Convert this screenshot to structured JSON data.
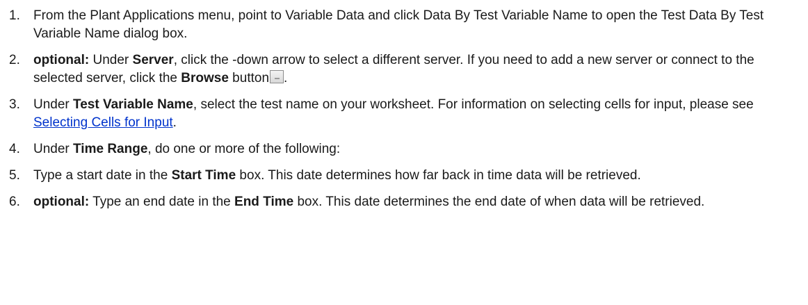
{
  "steps": [
    {
      "num": "1.",
      "parts": {
        "t1": "From the Plant Applications menu, point to Variable Data and click Data By Test Variable Name to open the Test Data By Test Variable Name dialog box."
      }
    },
    {
      "num": "2.",
      "parts": {
        "b1": "optional:",
        "t1": " Under ",
        "b2": "Server",
        "t2": ", click the -down arrow to select a different server. If you need to add a new server or connect to the selected server, click the ",
        "b3": "Browse",
        "t3": " button",
        "t4": "."
      },
      "icon": "browse-button-icon"
    },
    {
      "num": "3.",
      "parts": {
        "t1": "Under ",
        "b1": "Test Variable Name",
        "t2": ", select the test name on your worksheet. For information on selecting cells for input, please see ",
        "link": "Selecting Cells for Input",
        "t3": "."
      }
    },
    {
      "num": "4.",
      "parts": {
        "t1": "Under ",
        "b1": "Time Range",
        "t2": ", do one or more of the following:"
      }
    },
    {
      "num": "5.",
      "parts": {
        "t1": "Type a start date in the ",
        "b1": "Start Time",
        "t2": " box. This date determines how far back in time data will be retrieved."
      }
    },
    {
      "num": "6.",
      "parts": {
        "b1": "optional:",
        "t1": " Type an end date in the ",
        "b2": "End Time",
        "t2": " box. This date determines the end date of when data will be retrieved."
      }
    }
  ]
}
